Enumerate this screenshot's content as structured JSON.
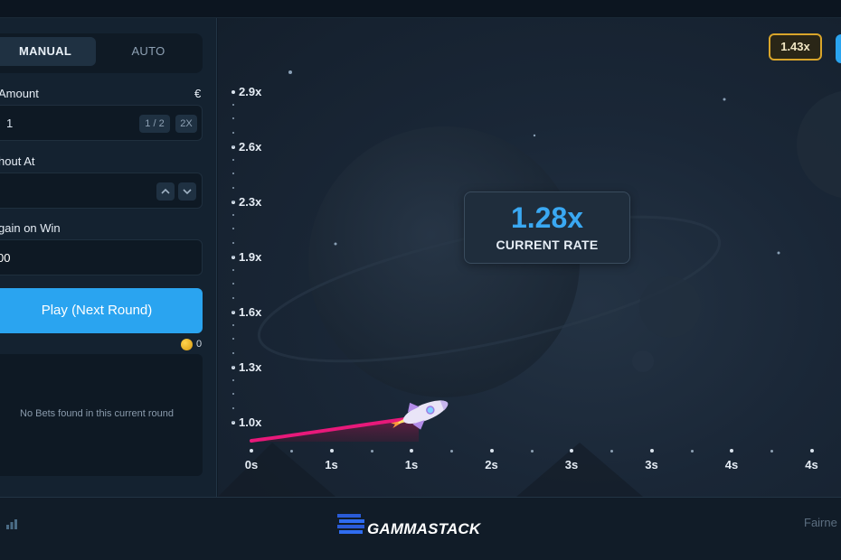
{
  "tabs": {
    "manual": "MANUAL",
    "auto": "AUTO"
  },
  "bet_amount": {
    "label": "Amount",
    "currency": "€",
    "value": "1",
    "half_label": "1 / 2",
    "double_label": "2X"
  },
  "cashout": {
    "label": "hout At",
    "value": ""
  },
  "stop_gain": {
    "label": "gain on Win",
    "value": "00"
  },
  "play_button": "Play (Next Round)",
  "balance": {
    "value": "0"
  },
  "bets": {
    "empty_text": "No Bets found in this current round"
  },
  "game": {
    "current_rate": "1.28x",
    "current_rate_label": "CURRENT RATE",
    "history": [
      "1.43x"
    ],
    "y_axis": [
      "2.9x",
      "2.6x",
      "2.3x",
      "1.9x",
      "1.6x",
      "1.3x",
      "1.0x"
    ],
    "x_axis": [
      "0s",
      "1s",
      "1s",
      "2s",
      "3s",
      "3s",
      "4s",
      "4s"
    ]
  },
  "footer": {
    "brand": "GAMMASTACK",
    "fairness": "Fairne"
  },
  "colors": {
    "accent": "#2aa4f0",
    "curve": "#e8197a",
    "history_border": "#d9a52a"
  }
}
